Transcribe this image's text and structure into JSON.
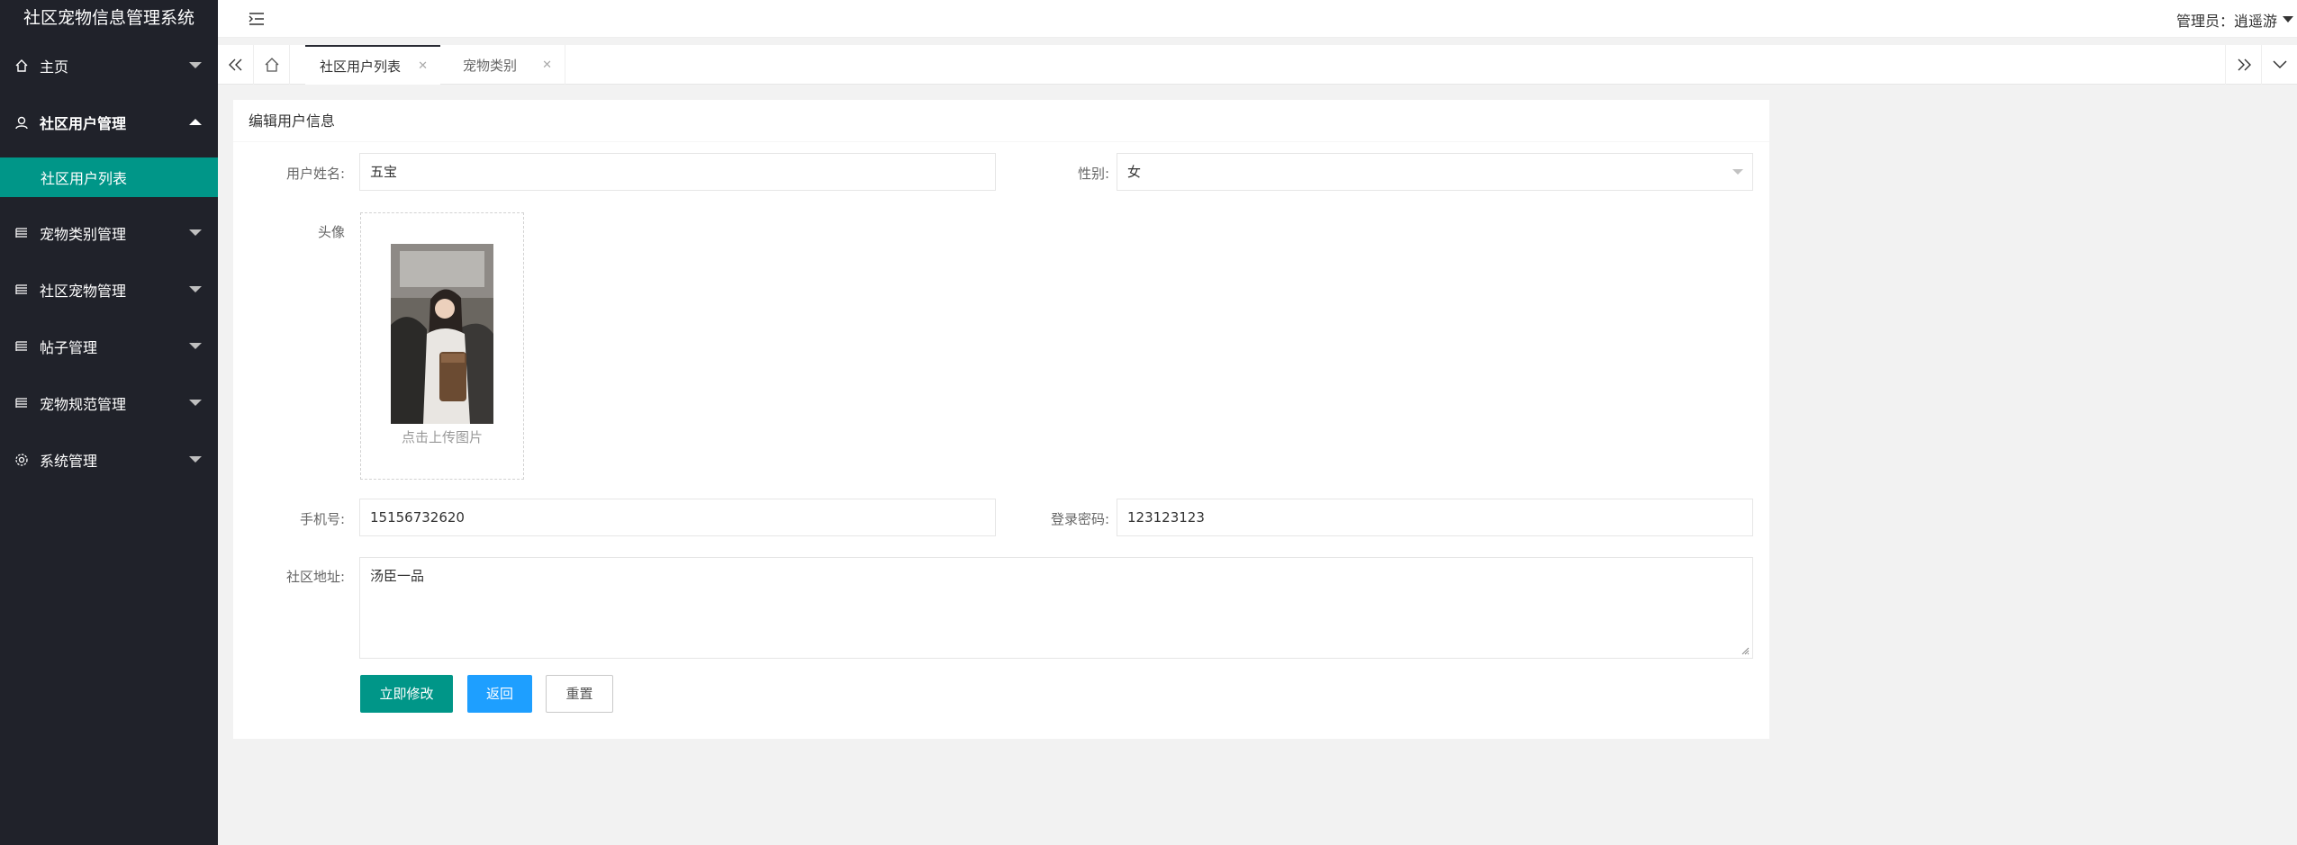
{
  "app": {
    "title": "社区宠物信息管理系统"
  },
  "sidebar": {
    "items": [
      {
        "label": "主页",
        "icon": "home-icon"
      },
      {
        "label": "社区用户管理",
        "icon": "user-icon",
        "open": true,
        "children": [
          {
            "label": "社区用户列表"
          }
        ]
      },
      {
        "label": "宠物类别管理",
        "icon": "list-icon"
      },
      {
        "label": "社区宠物管理",
        "icon": "list-icon"
      },
      {
        "label": "帖子管理",
        "icon": "list-icon"
      },
      {
        "label": "宠物规范管理",
        "icon": "list-icon"
      },
      {
        "label": "系统管理",
        "icon": "gear-icon"
      }
    ]
  },
  "header": {
    "admin_label": "管理员：逍遥游"
  },
  "tabs": [
    {
      "label": "社区用户列表",
      "active": true
    },
    {
      "label": "宠物类别",
      "active": false
    }
  ],
  "form": {
    "title": "编辑用户信息",
    "name_label": "用户姓名:",
    "name_value": "五宝",
    "gender_label": "性别:",
    "gender_value": "女",
    "avatar_label": "头像",
    "upload_hint": "点击上传图片",
    "phone_label": "手机号:",
    "phone_value": "15156732620",
    "password_label": "登录密码:",
    "password_value": "123123123",
    "address_label": "社区地址:",
    "address_value": "汤臣一品",
    "submit_label": "立即修改",
    "back_label": "返回",
    "reset_label": "重置"
  },
  "colors": {
    "sidebar_bg": "#20222a",
    "accent": "#009688",
    "blue": "#1e9fff"
  }
}
